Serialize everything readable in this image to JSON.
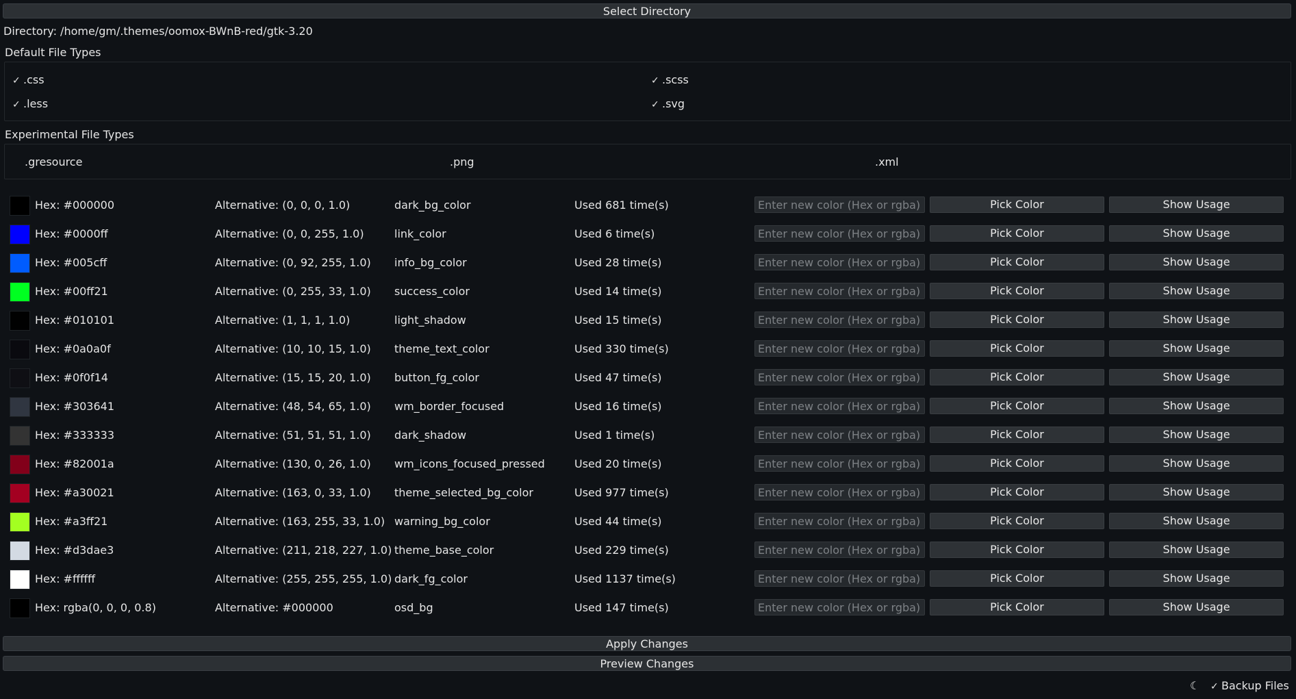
{
  "toolbar": {
    "select_directory": "Select Directory",
    "directory_text": "Directory: /home/gm/.themes/oomox-BWnB-red/gtk-3.20"
  },
  "default_types": {
    "title": "Default File Types",
    "items": [
      {
        "label": ".css",
        "checked": true
      },
      {
        "label": ".scss",
        "checked": true
      },
      {
        "label": ".less",
        "checked": true
      },
      {
        "label": ".svg",
        "checked": true
      }
    ]
  },
  "experimental_types": {
    "title": "Experimental File Types",
    "items": [
      {
        "label": ".gresource",
        "checked": false
      },
      {
        "label": ".png",
        "checked": false
      },
      {
        "label": ".xml",
        "checked": false
      }
    ]
  },
  "colors": [
    {
      "swatch": "#000000",
      "hex": "Hex: #000000",
      "alt": "Alternative: (0, 0, 0, 1.0)",
      "name": "dark_bg_color",
      "usage": "Used 681 time(s)"
    },
    {
      "swatch": "#0000ff",
      "hex": "Hex: #0000ff",
      "alt": "Alternative: (0, 0, 255, 1.0)",
      "name": "link_color",
      "usage": "Used 6 time(s)"
    },
    {
      "swatch": "#005cff",
      "hex": "Hex: #005cff",
      "alt": "Alternative: (0, 92, 255, 1.0)",
      "name": "info_bg_color",
      "usage": "Used 28 time(s)"
    },
    {
      "swatch": "#00ff21",
      "hex": "Hex: #00ff21",
      "alt": "Alternative: (0, 255, 33, 1.0)",
      "name": "success_color",
      "usage": "Used 14 time(s)"
    },
    {
      "swatch": "#010101",
      "hex": "Hex: #010101",
      "alt": "Alternative: (1, 1, 1, 1.0)",
      "name": "light_shadow",
      "usage": "Used 15 time(s)"
    },
    {
      "swatch": "#0a0a0f",
      "hex": "Hex: #0a0a0f",
      "alt": "Alternative: (10, 10, 15, 1.0)",
      "name": "theme_text_color",
      "usage": "Used 330 time(s)"
    },
    {
      "swatch": "#0f0f14",
      "hex": "Hex: #0f0f14",
      "alt": "Alternative: (15, 15, 20, 1.0)",
      "name": "button_fg_color",
      "usage": "Used 47 time(s)"
    },
    {
      "swatch": "#303641",
      "hex": "Hex: #303641",
      "alt": "Alternative: (48, 54, 65, 1.0)",
      "name": "wm_border_focused",
      "usage": "Used 16 time(s)"
    },
    {
      "swatch": "#333333",
      "hex": "Hex: #333333",
      "alt": "Alternative: (51, 51, 51, 1.0)",
      "name": "dark_shadow",
      "usage": "Used 1 time(s)"
    },
    {
      "swatch": "#82001a",
      "hex": "Hex: #82001a",
      "alt": "Alternative: (130, 0, 26, 1.0)",
      "name": "wm_icons_focused_pressed",
      "usage": "Used 20 time(s)"
    },
    {
      "swatch": "#a30021",
      "hex": "Hex: #a30021",
      "alt": "Alternative: (163, 0, 33, 1.0)",
      "name": "theme_selected_bg_color",
      "usage": "Used 977 time(s)"
    },
    {
      "swatch": "#a3ff21",
      "hex": "Hex: #a3ff21",
      "alt": "Alternative: (163, 255, 33, 1.0)",
      "name": "warning_bg_color",
      "usage": "Used 44 time(s)"
    },
    {
      "swatch": "#d3dae3",
      "hex": "Hex: #d3dae3",
      "alt": "Alternative: (211, 218, 227, 1.0)",
      "name": "theme_base_color",
      "usage": "Used 229 time(s)"
    },
    {
      "swatch": "#ffffff",
      "hex": "Hex: #ffffff",
      "alt": "Alternative: (255, 255, 255, 1.0)",
      "name": "dark_fg_color",
      "usage": "Used 1137 time(s)"
    },
    {
      "swatch": "#000000",
      "hex": "Hex: rgba(0, 0, 0, 0.8)",
      "alt": "Alternative: #000000",
      "name": "osd_bg",
      "usage": "Used 147 time(s)"
    }
  ],
  "row_controls": {
    "input_placeholder": "Enter new color (Hex or rgba)",
    "pick_label": "Pick Color",
    "usage_label": "Show Usage"
  },
  "footer": {
    "apply": "Apply Changes",
    "preview": "Preview Changes",
    "theme_icon": "moon-icon",
    "backup_label": "Backup Files",
    "backup_checked": true
  }
}
